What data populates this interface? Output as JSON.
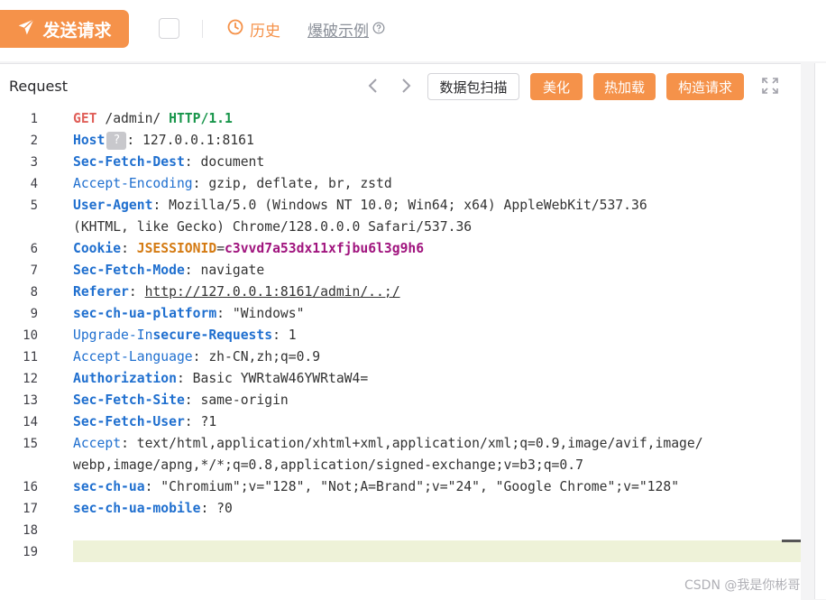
{
  "toolbar": {
    "send_label": "发送请求",
    "history_label": "历史",
    "example_label": "爆破示例"
  },
  "request": {
    "title": "Request",
    "scan_label": "数据包扫描",
    "beautify_label": "美化",
    "hotload_label": "热加载",
    "build_label": "构造请求"
  },
  "editor": {
    "line_numbers": [
      "1",
      "2",
      "3",
      "4",
      "5",
      "6",
      "7",
      "8",
      "9",
      "10",
      "11",
      "12",
      "13",
      "14",
      "15",
      "16",
      "17",
      "18",
      "19"
    ],
    "lines": {
      "l1": {
        "method": "GET",
        "path": " /admin/ ",
        "proto": "HTTP/1.1"
      },
      "l2": {
        "key": "Host",
        "hint": "?",
        "value": ": 127.0.0.1:8161"
      },
      "l3": {
        "key": "Sec-Fetch-Dest",
        "value": ": document"
      },
      "l4": {
        "key": "Accept-Encoding",
        "value": ": gzip, deflate, br, zstd"
      },
      "l5": {
        "key": "User-Agent",
        "value": ": Mozilla/5.0 (Windows NT 10.0; Win64; x64) AppleWebKit/537.36",
        "cont": "(KHTML, like Gecko) Chrome/128.0.0.0 Safari/537.36"
      },
      "l6": {
        "key": "Cookie",
        "sep": ": ",
        "ckey": "JSESSIONID",
        "eq": "=",
        "cval": "c3vvd7a53dx11xfjbu6l3g9h6"
      },
      "l7": {
        "key": "Sec-Fetch-Mode",
        "value": ": navigate"
      },
      "l8": {
        "key": "Referer",
        "sep": ": ",
        "url": "http://127.0.0.1:8161/admin/..;/"
      },
      "l9": {
        "key": "sec-ch-ua-platform",
        "value": ": \"Windows\""
      },
      "l10": {
        "key_a": "Upgrade-In",
        "key_b": "secure-Requests",
        "value": ": 1"
      },
      "l11": {
        "key": "Accept-Language",
        "value": ": zh-CN,zh;q=0.9"
      },
      "l12": {
        "key": "Authorization",
        "value": ": Basic YWRtaW46YWRtaW4="
      },
      "l13": {
        "key": "Sec-Fetch-Site",
        "value": ": same-origin"
      },
      "l14": {
        "key": "Sec-Fetch-User",
        "value": ": ?1"
      },
      "l15": {
        "key": "Accept",
        "value": ": text/html,application/xhtml+xml,application/xml;q=0.9,image/avif,image/",
        "cont": "webp,image/apng,*/*;q=0.8,application/signed-exchange;v=b3;q=0.7"
      },
      "l16": {
        "key": "sec-ch-ua",
        "value": ": \"Chromium\";v=\"128\", \"Not;A=Brand\";v=\"24\", \"Google Chrome\";v=\"128\""
      },
      "l17": {
        "key": "sec-ch-ua-mobile",
        "value": ": ?0"
      }
    }
  },
  "watermark": "CSDN @我是你彬哥",
  "colors": {
    "accent": "#f5924a",
    "header_key": "#1f6fcf",
    "method": "#e0605a",
    "protocol": "#17954a",
    "cookie_key": "#d47a12",
    "cookie_value": "#a0147e"
  },
  "icons": [
    "send-icon",
    "history-clock-icon",
    "help-circle-icon",
    "chevron-left-icon",
    "chevron-right-icon",
    "fullscreen-icon"
  ]
}
